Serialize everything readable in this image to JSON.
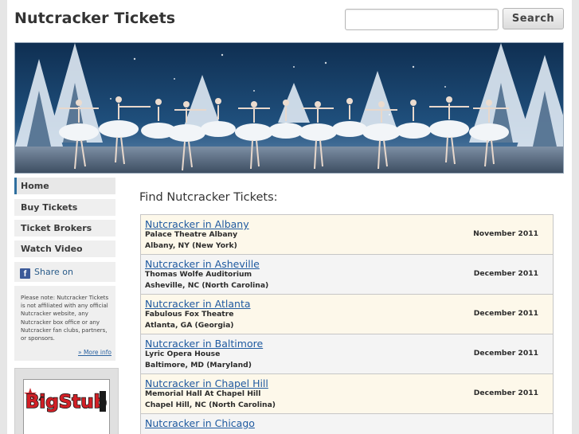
{
  "site": {
    "title": "Nutcracker Tickets"
  },
  "search": {
    "placeholder": "",
    "value": "",
    "button_label": "Search"
  },
  "banner": {
    "icon": "ballet-photo-banner"
  },
  "sidebar": {
    "nav": [
      {
        "label": "Home",
        "active": true
      },
      {
        "label": "Buy Tickets"
      },
      {
        "label": "Ticket Brokers"
      },
      {
        "label": "Watch Video"
      }
    ],
    "facebook_share": "Share on Facebook",
    "facebook_icon": "facebook-icon",
    "disclaimer": "Please note: Nutcracker Tickets is not affiliated with any official Nutcracker website, any Nutcracker box office or any Nutcracker fan clubs, partners, or sponsors.",
    "more_info": "» More info",
    "ad_logo_text": "BigStub"
  },
  "main": {
    "heading": "Find Nutcracker Tickets:",
    "events": [
      {
        "title": "Nutcracker in Albany",
        "venue": "Palace Theatre Albany",
        "city": "Albany, NY (New York)",
        "date": "November 2011"
      },
      {
        "title": "Nutcracker in Asheville",
        "venue": "Thomas Wolfe Auditorium",
        "city": "Asheville, NC (North Carolina)",
        "date": "December 2011"
      },
      {
        "title": "Nutcracker in Atlanta",
        "venue": "Fabulous Fox Theatre",
        "city": "Atlanta, GA (Georgia)",
        "date": "December 2011"
      },
      {
        "title": "Nutcracker in Baltimore",
        "venue": "Lyric Opera House",
        "city": "Baltimore, MD (Maryland)",
        "date": "December 2011"
      },
      {
        "title": "Nutcracker in Chapel Hill",
        "venue": "Memorial Hall At Chapel Hill",
        "city": "Chapel Hill, NC (North Carolina)",
        "date": "December 2011"
      },
      {
        "title": "Nutcracker in Chicago",
        "venue": "",
        "city": "",
        "date": ""
      }
    ]
  },
  "colors": {
    "link": "#1f5aa0",
    "accent": "#2f6f9f",
    "row_odd": "#fdf8ea",
    "row_even": "#f4f4f4",
    "facebook": "#3b5998"
  }
}
